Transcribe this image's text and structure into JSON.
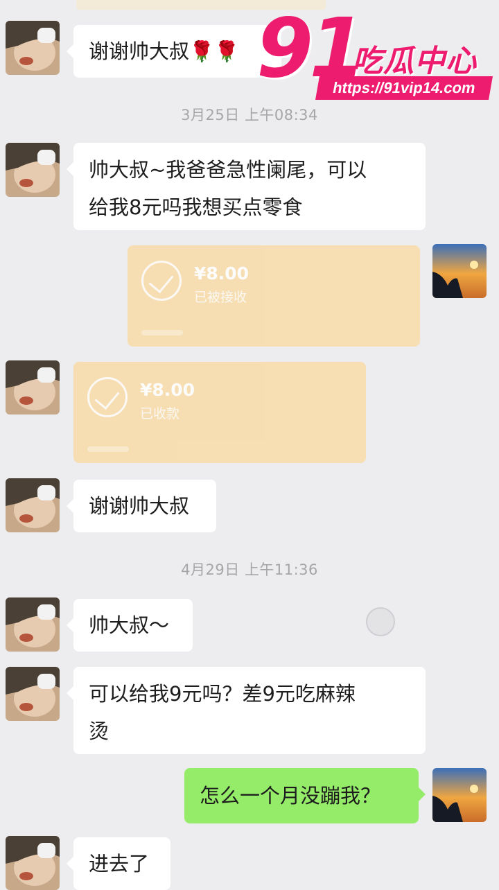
{
  "watermark": {
    "number": "91",
    "name": "吃瓜中心",
    "url": "https://91vip14.com"
  },
  "messages": [
    {
      "text": "谢谢帅大叔🌹🌹"
    },
    {
      "timestamp": "3月25日 上午08:34"
    },
    {
      "text_line1": "帅大叔~我爸爸急性阑尾，可以",
      "text_line2": "给我8元吗我想买点零食"
    },
    {
      "transfer_amount": "¥8.00",
      "transfer_status": "已被接收"
    },
    {
      "transfer_amount": "¥8.00",
      "transfer_status": "已收款"
    },
    {
      "text": "谢谢帅大叔"
    },
    {
      "timestamp": "4月29日 上午11:36"
    },
    {
      "text": "帅大叔～"
    },
    {
      "text_line1": "可以给我9元吗？差9元吃麻辣",
      "text_line2": "烫"
    },
    {
      "text": "怎么一个月没蹦我？"
    },
    {
      "text": "进去了"
    }
  ],
  "colors": {
    "background": "#ededf0",
    "my_bubble": "#95ec69",
    "their_bubble": "#ffffff",
    "transfer": "#f8dca8",
    "watermark": "#ee1c6e"
  }
}
